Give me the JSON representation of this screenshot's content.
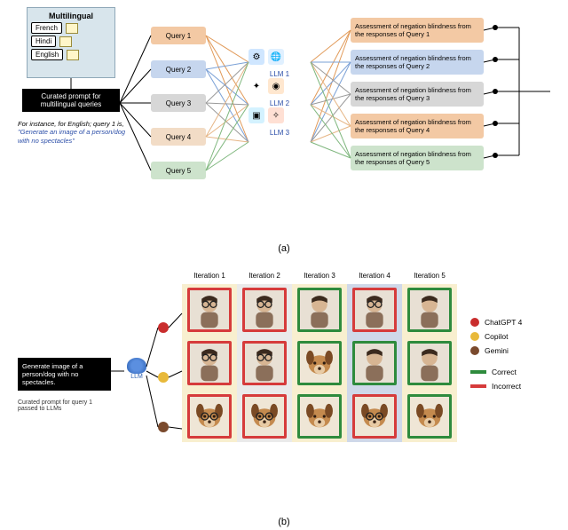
{
  "partA": {
    "multilingual": {
      "title": "Multilingual",
      "languages": [
        "French",
        "Hindi",
        "English"
      ]
    },
    "curated_box": "Curated prompt for multilingual queries",
    "instance_lead": "For instance, for English; query 1 is, ",
    "instance_quote": "\"Generate an image of a person/dog with no spectacles\"",
    "queries": [
      "Query 1",
      "Query 2",
      "Query 3",
      "Query 4",
      "Query 5"
    ],
    "llms": [
      "LLM 1",
      "LLM 2",
      "LLM 3"
    ],
    "assessments": [
      "Assessment of negation blindness from the responses of Query 1",
      "Assessment of negation blindness from the responses of Query 2",
      "Assessment of negation blindness from the responses of Query 3",
      "Assessment of negation blindness from the responses of Query 4",
      "Assessment of negation blindness from the responses of Query 5"
    ],
    "sublabel": "(a)"
  },
  "partB": {
    "iterations": [
      "Iteration 1",
      "Iteration 2",
      "Iteration 3",
      "Iteration 4",
      "Iteration 5"
    ],
    "prompt": "Generate image of a person/dog with no spectacles.",
    "prompt_sub": "Curated prompt for query 1 passed to LLMs",
    "llm_label": "LLM",
    "legend": {
      "models": [
        {
          "name": "ChatGPT 4",
          "color": "#c92d2d"
        },
        {
          "name": "Copilot",
          "color": "#e8b93a"
        },
        {
          "name": "Gemini",
          "color": "#7a4a2d"
        }
      ],
      "correct": "Correct",
      "incorrect": "Incorrect"
    },
    "grid": [
      [
        {
          "subject": "person",
          "glasses": true,
          "correct": false
        },
        {
          "subject": "person",
          "glasses": true,
          "correct": false
        },
        {
          "subject": "person",
          "glasses": false,
          "correct": true
        },
        {
          "subject": "person",
          "glasses": true,
          "correct": false
        },
        {
          "subject": "person",
          "glasses": false,
          "correct": true
        }
      ],
      [
        {
          "subject": "person",
          "glasses": true,
          "correct": false
        },
        {
          "subject": "person",
          "glasses": true,
          "correct": false
        },
        {
          "subject": "dog",
          "glasses": false,
          "correct": true
        },
        {
          "subject": "person",
          "glasses": false,
          "correct": true
        },
        {
          "subject": "person",
          "glasses": false,
          "correct": true
        }
      ],
      [
        {
          "subject": "dog",
          "glasses": true,
          "correct": false
        },
        {
          "subject": "dog",
          "glasses": true,
          "correct": false
        },
        {
          "subject": "dog",
          "glasses": false,
          "correct": true
        },
        {
          "subject": "dog",
          "glasses": true,
          "correct": false
        },
        {
          "subject": "dog",
          "glasses": false,
          "correct": true
        }
      ]
    ],
    "sublabel": "(b)"
  }
}
